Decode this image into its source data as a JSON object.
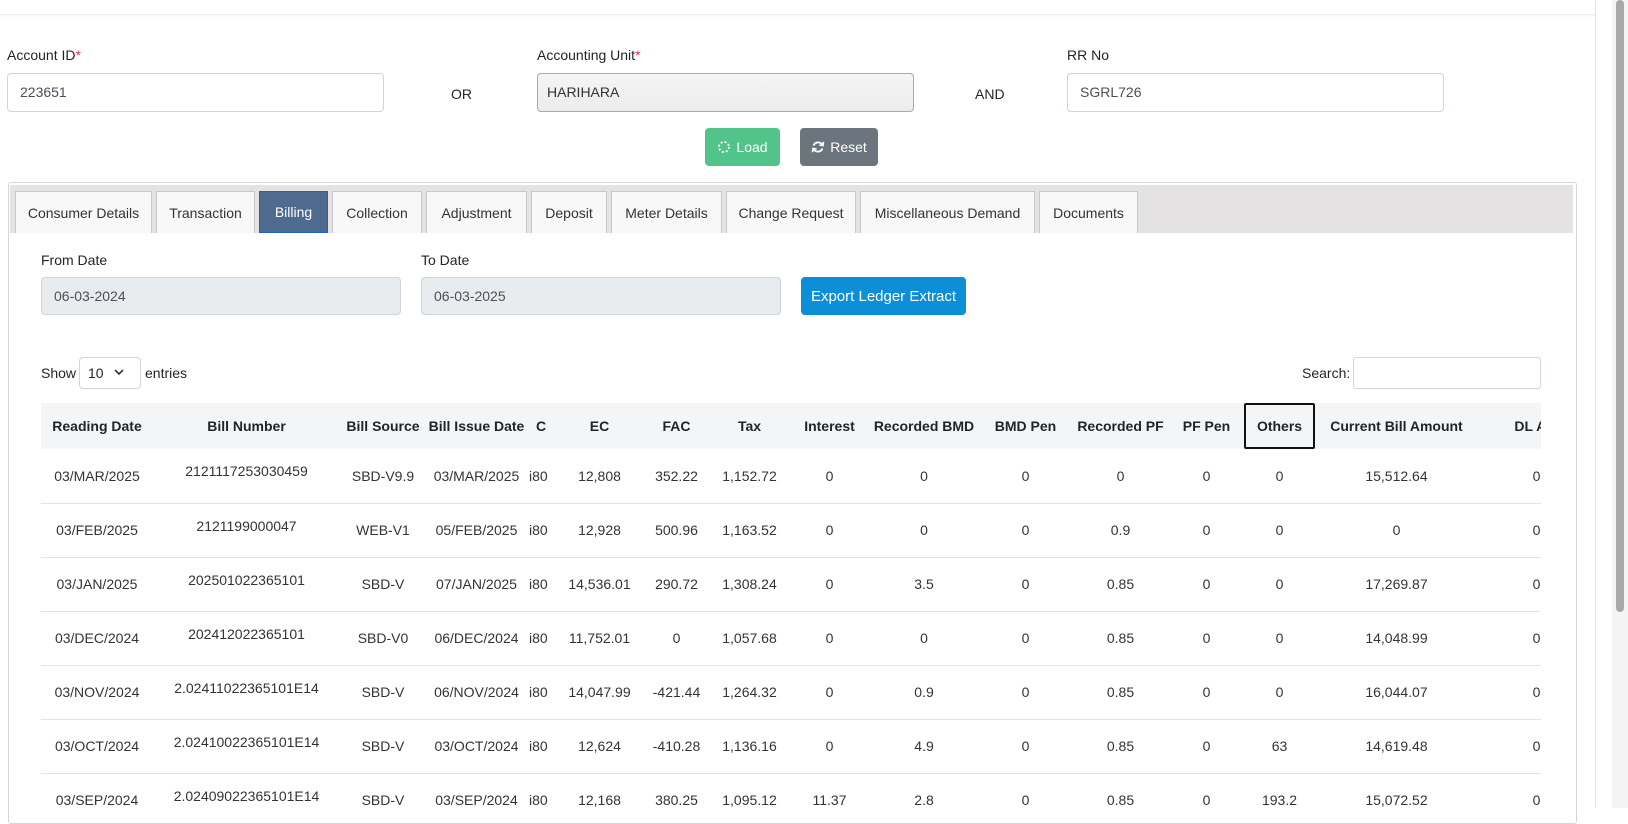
{
  "search_form": {
    "account_id_label": "Account ID",
    "account_id_value": "223651",
    "or_text": "OR",
    "accounting_unit_label": "Accounting Unit",
    "accounting_unit_value": "HARIHARA",
    "and_text": "AND",
    "rr_no_label": "RR No",
    "rr_no_value": "SGRL726",
    "required_mark": "*",
    "load_label": "Load",
    "reset_label": "Reset"
  },
  "tabs": [
    {
      "label": "Consumer Details"
    },
    {
      "label": "Transaction"
    },
    {
      "label": "Billing",
      "active": true
    },
    {
      "label": "Collection"
    },
    {
      "label": "Adjustment"
    },
    {
      "label": "Deposit"
    },
    {
      "label": "Meter Details"
    },
    {
      "label": "Change Request"
    },
    {
      "label": "Miscellaneous Demand"
    },
    {
      "label": "Documents"
    }
  ],
  "billing": {
    "from_date_label": "From Date",
    "from_date_value": "06-03-2024",
    "to_date_label": "To Date",
    "to_date_value": "06-03-2025",
    "export_label": "Export Ledger Extract",
    "show_label": "Show",
    "entries_value": "10",
    "entries_label": "entries",
    "search_label": "Search:"
  },
  "table": {
    "columns": [
      "Reading Date",
      "Bill Number",
      "Bill Source",
      "Bill Issue Date",
      "C",
      "EC",
      "FAC",
      "Tax",
      "Interest",
      "Recorded BMD",
      "BMD Pen",
      "Recorded PF",
      "PF Pen",
      "Others",
      "Current Bill Amount",
      "DL Adj"
    ],
    "rows": [
      [
        "03/MAR/2025",
        "2121117253030459",
        "SBD-V9.9",
        "03/MAR/2025",
        "i80",
        "12,808",
        "352.22",
        "1,152.72",
        "0",
        "0",
        "0",
        "0",
        "0",
        "0",
        "15,512.64",
        "0"
      ],
      [
        "03/FEB/2025",
        "2121199000047",
        "WEB-V1",
        "05/FEB/2025",
        "i80",
        "12,928",
        "500.96",
        "1,163.52",
        "0",
        "0",
        "0",
        "0.9",
        "0",
        "0",
        "0",
        "0"
      ],
      [
        "03/JAN/2025",
        "202501022365101",
        "SBD-V",
        "07/JAN/2025",
        "i80",
        "14,536.01",
        "290.72",
        "1,308.24",
        "0",
        "3.5",
        "0",
        "0.85",
        "0",
        "0",
        "17,269.87",
        "0"
      ],
      [
        "03/DEC/2024",
        "202412022365101",
        "SBD-V0",
        "06/DEC/2024",
        "i80",
        "11,752.01",
        "0",
        "1,057.68",
        "0",
        "0",
        "0",
        "0.85",
        "0",
        "0",
        "14,048.99",
        "0"
      ],
      [
        "03/NOV/2024",
        "2.02411022365101E14",
        "SBD-V",
        "06/NOV/2024",
        "i80",
        "14,047.99",
        "-421.44",
        "1,264.32",
        "0",
        "0.9",
        "0",
        "0.85",
        "0",
        "0",
        "16,044.07",
        "0"
      ],
      [
        "03/OCT/2024",
        "2.02410022365101E14",
        "SBD-V",
        "03/OCT/2024",
        "i80",
        "12,624",
        "-410.28",
        "1,136.16",
        "0",
        "4.9",
        "0",
        "0.85",
        "0",
        "63",
        "14,619.48",
        "0"
      ],
      [
        "03/SEP/2024",
        "2.02409022365101E14",
        "SBD-V",
        "03/SEP/2024",
        "i80",
        "12,168",
        "380.25",
        "1,095.12",
        "11.37",
        "2.8",
        "0",
        "0.85",
        "0",
        "193.2",
        "15,072.52",
        "0"
      ]
    ]
  },
  "colors": {
    "load_button": "#52c38a",
    "reset_button": "#6c757d",
    "export_button": "#0d8fd8",
    "active_tab": "#4e6a8e",
    "required": "#dc3545"
  }
}
